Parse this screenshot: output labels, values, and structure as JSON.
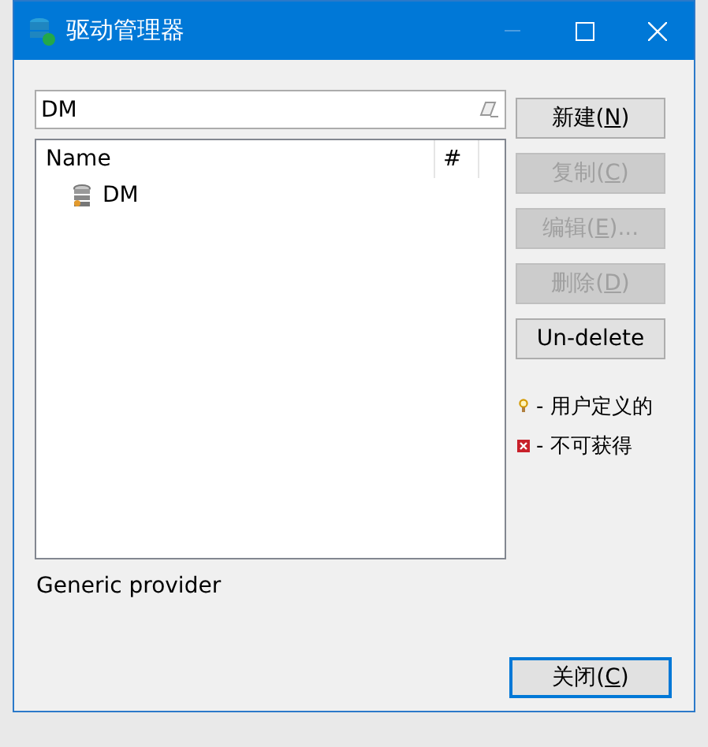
{
  "window": {
    "title": "驱动管理器"
  },
  "search": {
    "value": "DM"
  },
  "list": {
    "columns": [
      "Name",
      "#"
    ],
    "items": [
      {
        "name": "DM",
        "selected": false
      }
    ]
  },
  "buttons": [
    {
      "label": "新建(",
      "accesskey": "N",
      "label_end": ")",
      "disabled": false
    },
    {
      "label": "复制(",
      "accesskey": "C",
      "label_end": ")",
      "disabled": true
    },
    {
      "label": "编辑(",
      "accesskey": "E",
      "label_end": ")...",
      "disabled": true
    },
    {
      "label": "删除(",
      "accesskey": "D",
      "label_end": ")",
      "disabled": true
    },
    {
      "label": "Un-delete",
      "disabled": false
    }
  ],
  "legend": [
    {
      "kind": "user",
      "text": "- 用户定义的"
    },
    {
      "kind": "unavailable",
      "text": "- 不可获得"
    }
  ],
  "description": "Generic provider",
  "close_button": {
    "label": "关闭(",
    "accesskey": "C",
    "label_end": ")",
    "focused": true
  }
}
